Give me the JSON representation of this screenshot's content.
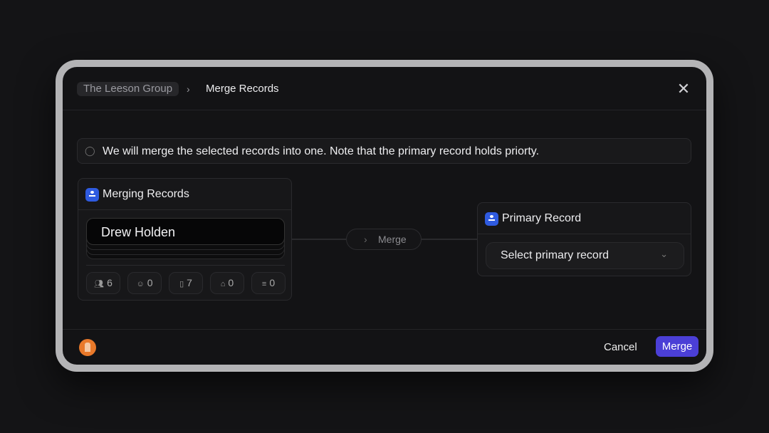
{
  "breadcrumb": {
    "parent": "The Leeson Group",
    "current": "Merge Records"
  },
  "notice": "We will merge the selected records into one. Note that the primary record holds priorty.",
  "merging": {
    "title": "Merging Records",
    "front_record": "Drew Holden",
    "stats": [
      {
        "icon": "people-icon",
        "value": "6"
      },
      {
        "icon": "people-outline-icon",
        "value": "0"
      },
      {
        "icon": "document-icon",
        "value": "7"
      },
      {
        "icon": "buildings-icon",
        "value": "0"
      },
      {
        "icon": "list-icon",
        "value": "0"
      }
    ]
  },
  "connector": {
    "label": "Merge"
  },
  "primary": {
    "title": "Primary Record",
    "select_placeholder": "Select primary record"
  },
  "footer": {
    "cancel": "Cancel",
    "merge": "Merge"
  },
  "colors": {
    "accent": "#4b3fd6",
    "badge": "#2f5be0",
    "logo": "#e9792a"
  }
}
